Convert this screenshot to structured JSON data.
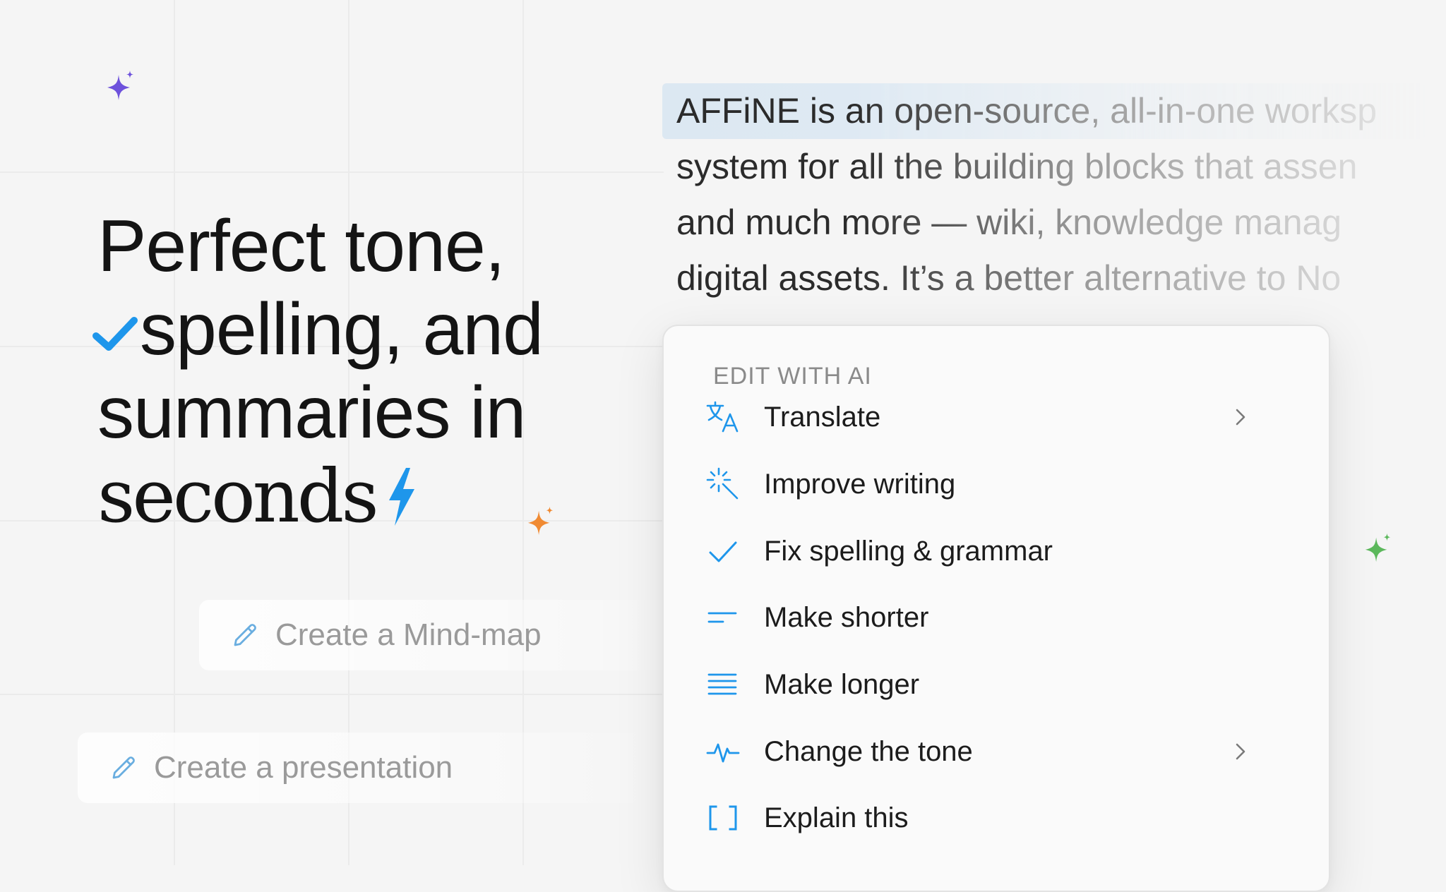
{
  "headline": {
    "line1": "Perfect tone,",
    "line2": "spelling, and",
    "line3": "summaries in",
    "line4": "seconds"
  },
  "suggestions": [
    {
      "label": "Create a Mind-map",
      "icon": "pencil-icon"
    },
    {
      "label": "Create a presentation",
      "icon": "pencil-icon"
    }
  ],
  "document": {
    "lines": [
      "AFFiNE is an open-source, all-in-one worksp",
      "system for all the building blocks that assen",
      "and much more — wiki, knowledge manag",
      "digital assets. It’s a better alternative to No"
    ]
  },
  "menu": {
    "heading": "EDIT WITH AI",
    "items": [
      {
        "label": "Translate",
        "icon": "translate-icon",
        "submenu": true
      },
      {
        "label": "Improve writing",
        "icon": "sparkle-burst-icon",
        "submenu": false
      },
      {
        "label": "Fix spelling & grammar",
        "icon": "check-icon",
        "submenu": false
      },
      {
        "label": "Make shorter",
        "icon": "short-lines-icon",
        "submenu": false
      },
      {
        "label": "Make longer",
        "icon": "long-lines-icon",
        "submenu": false
      },
      {
        "label": "Change the tone",
        "icon": "pulse-icon",
        "submenu": true
      },
      {
        "label": "Explain this",
        "icon": "brackets-icon",
        "submenu": false
      }
    ]
  },
  "colors": {
    "accent": "#1e96eb",
    "sparkle_purple": "#6e52dc",
    "sparkle_orange": "#f08a32",
    "sparkle_green": "#5cb85c",
    "selection": "#dce8f2"
  }
}
